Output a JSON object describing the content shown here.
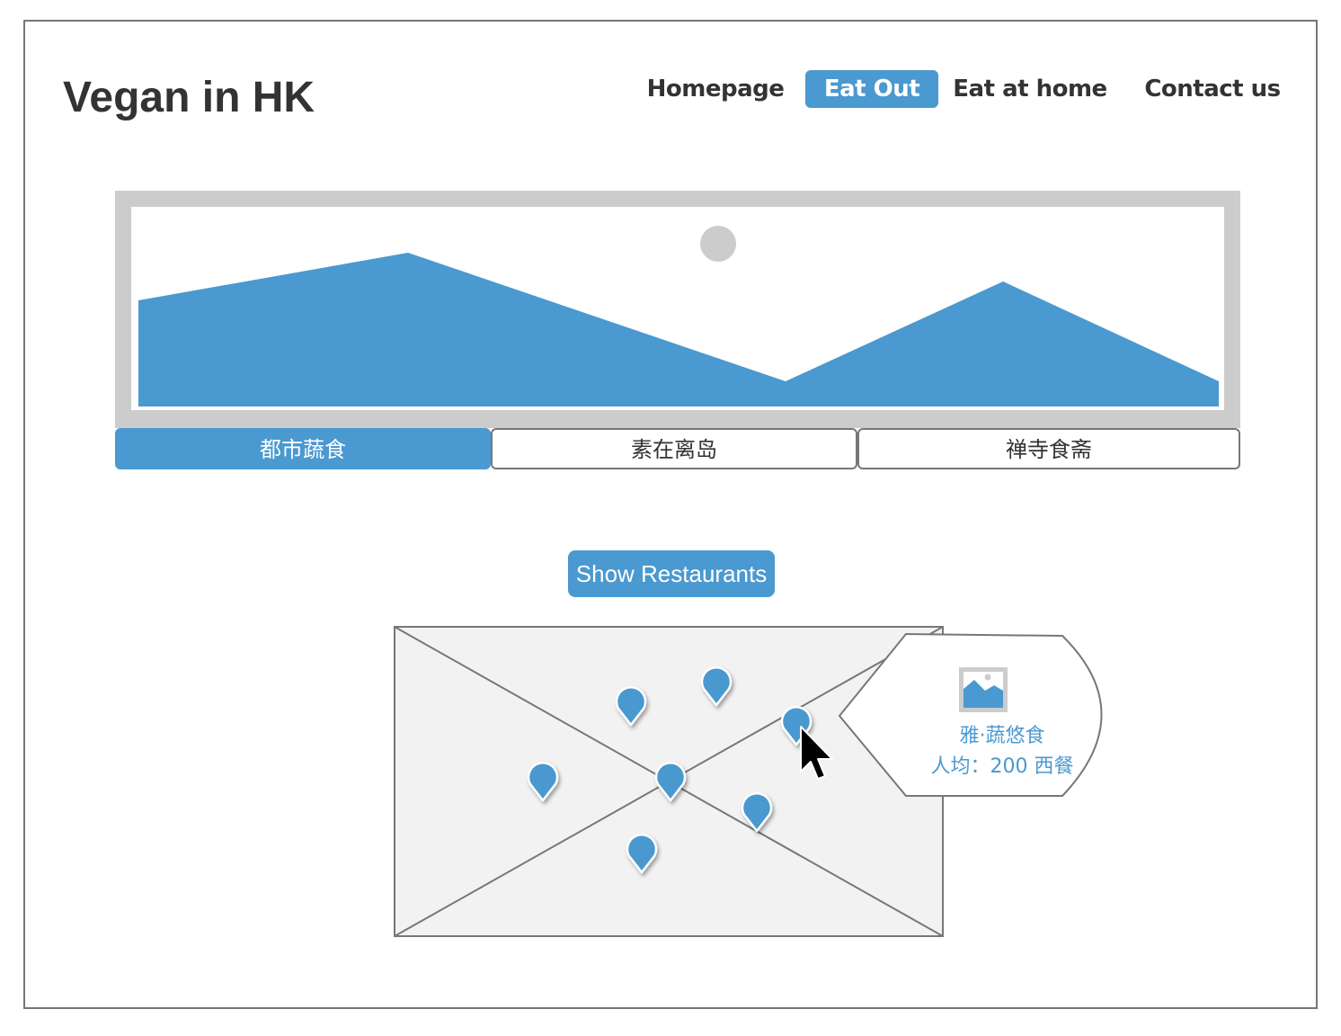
{
  "header": {
    "brand": "Vegan in HK",
    "nav": [
      {
        "label": "Homepage"
      },
      {
        "label": "Eat Out"
      },
      {
        "label": "Eat at home"
      },
      {
        "label": "Contact us"
      }
    ],
    "active_nav": "Eat Out"
  },
  "hero": {
    "image_icon": "landscape-image-placeholder"
  },
  "tabs": [
    {
      "label": "都市蔬食"
    },
    {
      "label": "素在离岛"
    },
    {
      "label": "禅寺食斋"
    }
  ],
  "active_tab": "都市蔬食",
  "show_button": {
    "label": "Show Restaurants"
  },
  "map": {
    "pin_icon": "map-pin-icon",
    "pin_count": 7
  },
  "popup": {
    "image_icon": "image-placeholder-icon",
    "name": "雅·蔬悠食",
    "detail": "人均：200 西餐"
  },
  "colors": {
    "accent": "#4a99d0",
    "border": "#777777",
    "placeholder": "#cccccc",
    "map_bg": "#f2f2f2"
  }
}
